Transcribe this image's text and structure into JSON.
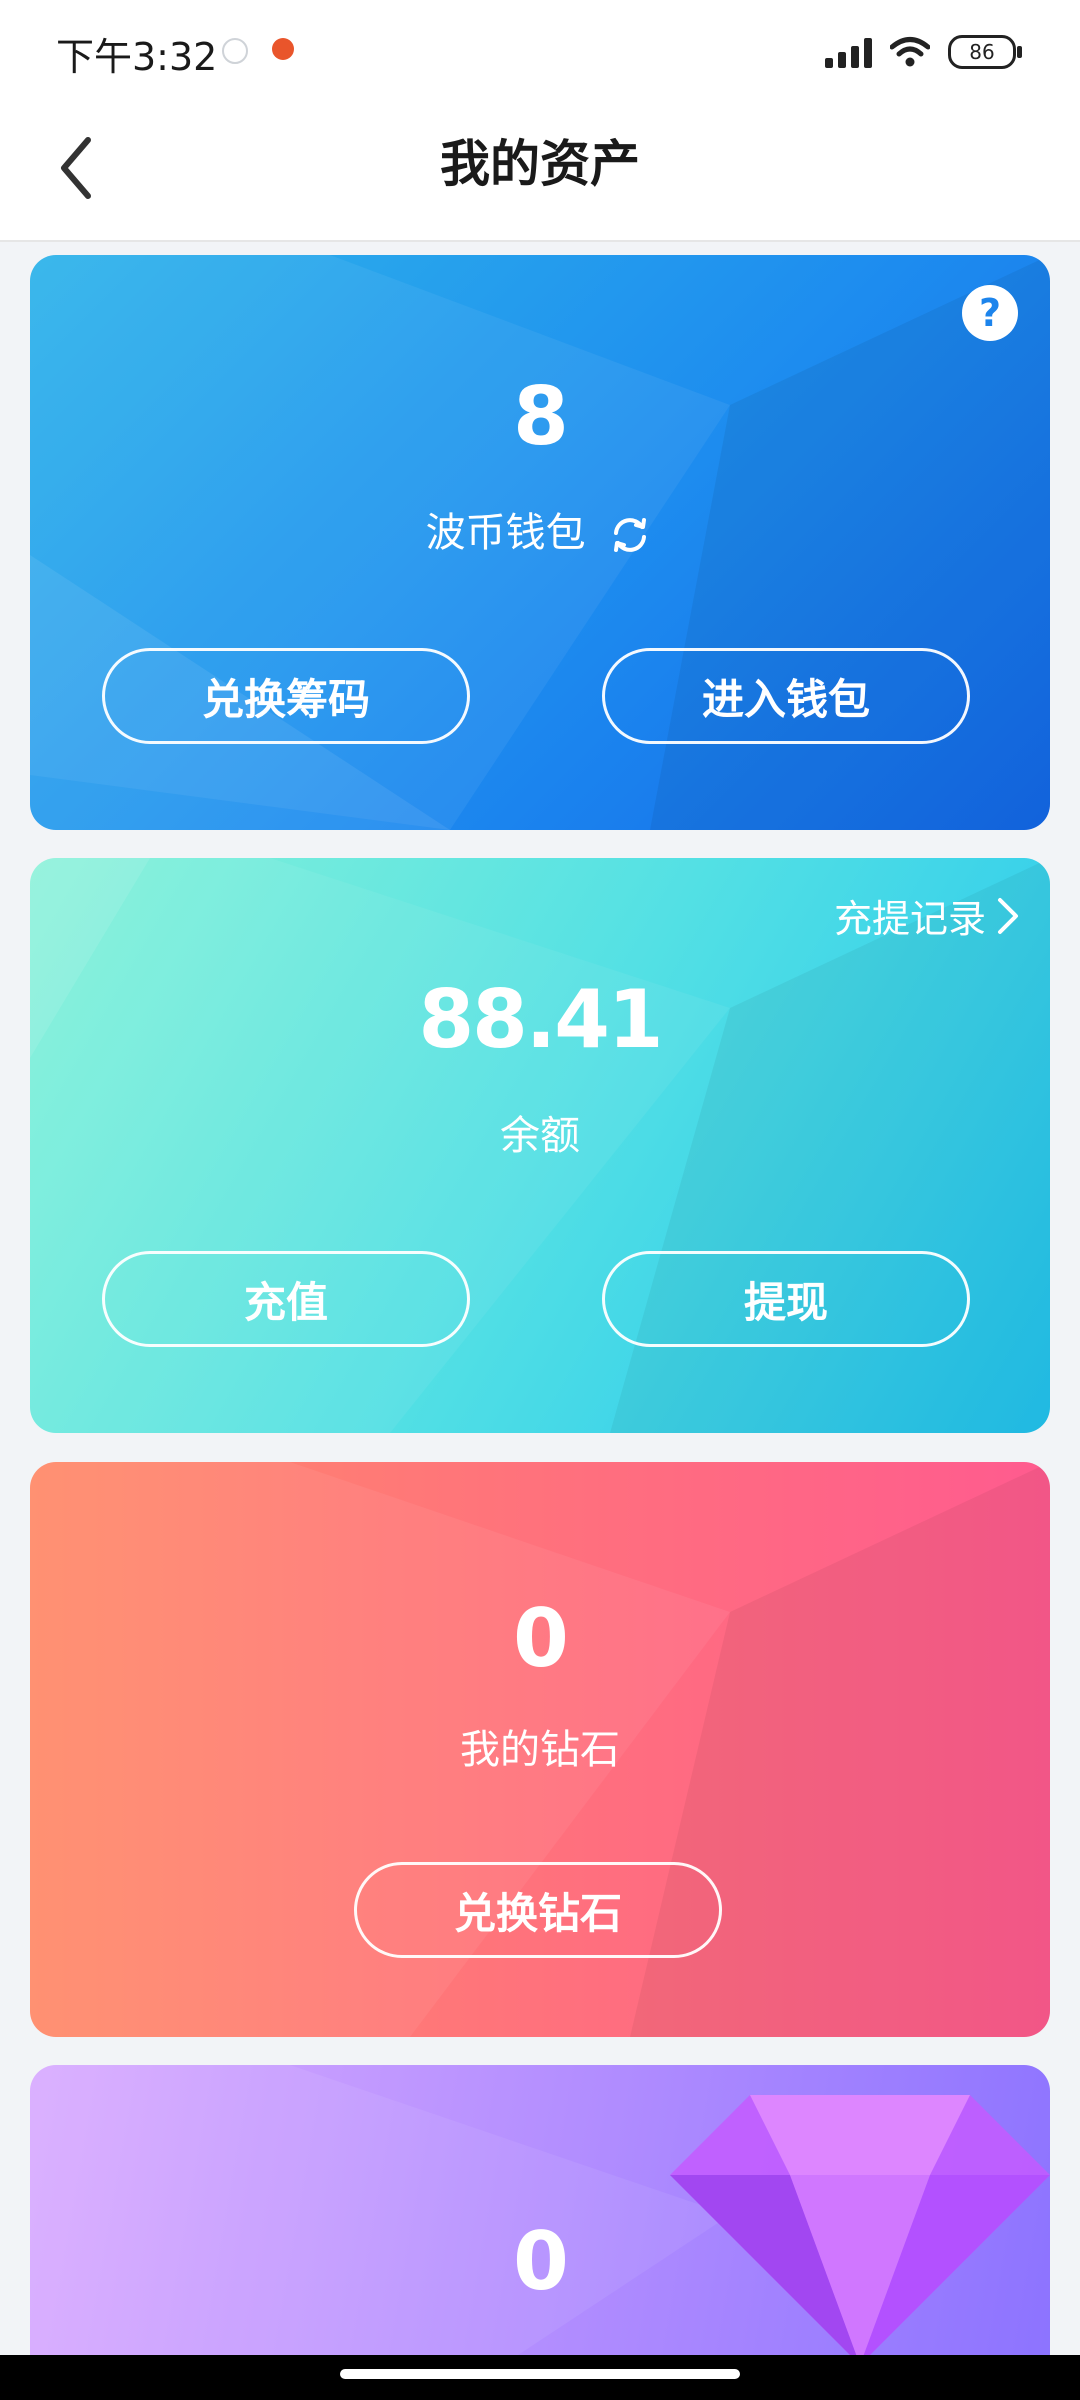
{
  "status": {
    "time": "下午3:32",
    "battery": "86",
    "colors": {
      "notif1": "#cfd3d8",
      "notif2": "#e9552b"
    }
  },
  "header": {
    "title": "我的资产",
    "back_icon": "chevron-left-icon"
  },
  "cards": {
    "wallet": {
      "value": "8",
      "label": "波币钱包",
      "buttons": [
        "兑换筹码",
        "进入钱包"
      ],
      "help_icon_text": "?",
      "gradient": [
        "#2fb4ea",
        "#1d8cef",
        "#1469ea"
      ]
    },
    "balance": {
      "value": "88.41",
      "label": "余额",
      "records_label": "充提记录",
      "buttons": [
        "充值",
        "提现"
      ],
      "gradient": [
        "#7ff0da",
        "#4fdfe6",
        "#23c8ee"
      ]
    },
    "diamond": {
      "value": "0",
      "label": "我的钻石",
      "button": "兑换钻石",
      "gradient": [
        "#ff8b6a",
        "#ff6f7e",
        "#ff5b8f"
      ]
    },
    "fourth": {
      "value": "0",
      "gradient": [
        "#d7a7ff",
        "#b18bff",
        "#8f76ff"
      ]
    }
  }
}
